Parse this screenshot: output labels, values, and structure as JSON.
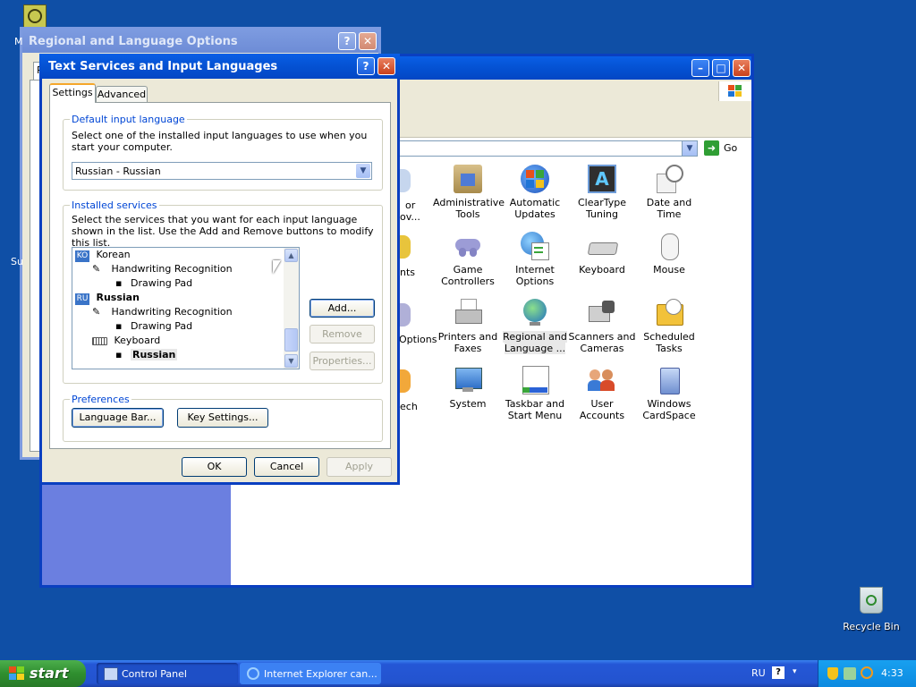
{
  "desktop": {
    "recycle_bin_label": "Recycle Bin"
  },
  "control_panel": {
    "go_label": "Go",
    "items": [
      {
        "label": "Administrative Tools",
        "icon": "admin-tools-icon"
      },
      {
        "label": "Automatic Updates",
        "icon": "automatic-updates-icon"
      },
      {
        "label": "ClearType Tuning",
        "icon": "cleartype-icon"
      },
      {
        "label": "Date and Time",
        "icon": "date-time-icon"
      },
      {
        "label": "Game Controllers",
        "icon": "game-controller-icon"
      },
      {
        "label": "Internet Options",
        "icon": "internet-options-icon"
      },
      {
        "label": "Keyboard",
        "icon": "keyboard-icon"
      },
      {
        "label": "Mouse",
        "icon": "mouse-icon"
      },
      {
        "label": "Printers and Faxes",
        "icon": "printer-icon"
      },
      {
        "label": "Regional and Language ...",
        "icon": "globe-icon"
      },
      {
        "label": "Scanners and Cameras",
        "icon": "scanner-icon"
      },
      {
        "label": "Scheduled Tasks",
        "icon": "scheduled-tasks-icon"
      },
      {
        "label": "System",
        "icon": "system-icon"
      },
      {
        "label": "Taskbar and Start Menu",
        "icon": "taskbar-icon"
      },
      {
        "label": "User Accounts",
        "icon": "user-accounts-icon"
      },
      {
        "label": "Windows CardSpace",
        "icon": "cardspace-icon"
      }
    ],
    "partial_labels": [
      "or",
      "ov...",
      "nts",
      "Options",
      "ech"
    ]
  },
  "regional_window": {
    "title": "Regional and Language Options"
  },
  "dialog": {
    "title": "Text Services and Input Languages",
    "tabs": [
      "Settings",
      "Advanced"
    ],
    "default_group_label": "Default input language",
    "default_desc": "Select one of the installed input languages to use when you start your computer.",
    "default_value": "Russian - Russian",
    "installed_group_label": "Installed services",
    "installed_desc": "Select the services that you want for each input language shown in the list. Use the Add and Remove buttons to modify this list.",
    "tree": {
      "korean_badge": "KO",
      "korean": "Korean",
      "handwriting_1": "Handwriting Recognition",
      "drawing_pad_1": "Drawing Pad",
      "russian_badge": "RU",
      "russian": "Russian",
      "handwriting_2": "Handwriting Recognition",
      "drawing_pad_2": "Drawing Pad",
      "keyboard": "Keyboard",
      "russian_layout": "Russian"
    },
    "add_label": "Add...",
    "remove_label": "Remove",
    "properties_label": "Properties...",
    "preferences_label": "Preferences",
    "language_bar_label": "Language Bar...",
    "key_settings_label": "Key Settings...",
    "ok_label": "OK",
    "cancel_label": "Cancel",
    "apply_label": "Apply"
  },
  "taskbar": {
    "start_label": "start",
    "tasks": [
      {
        "label": "Control Panel"
      },
      {
        "label": "Internet Explorer can..."
      }
    ],
    "language": "RU",
    "help_glyph": "?",
    "clock": "4:33"
  }
}
